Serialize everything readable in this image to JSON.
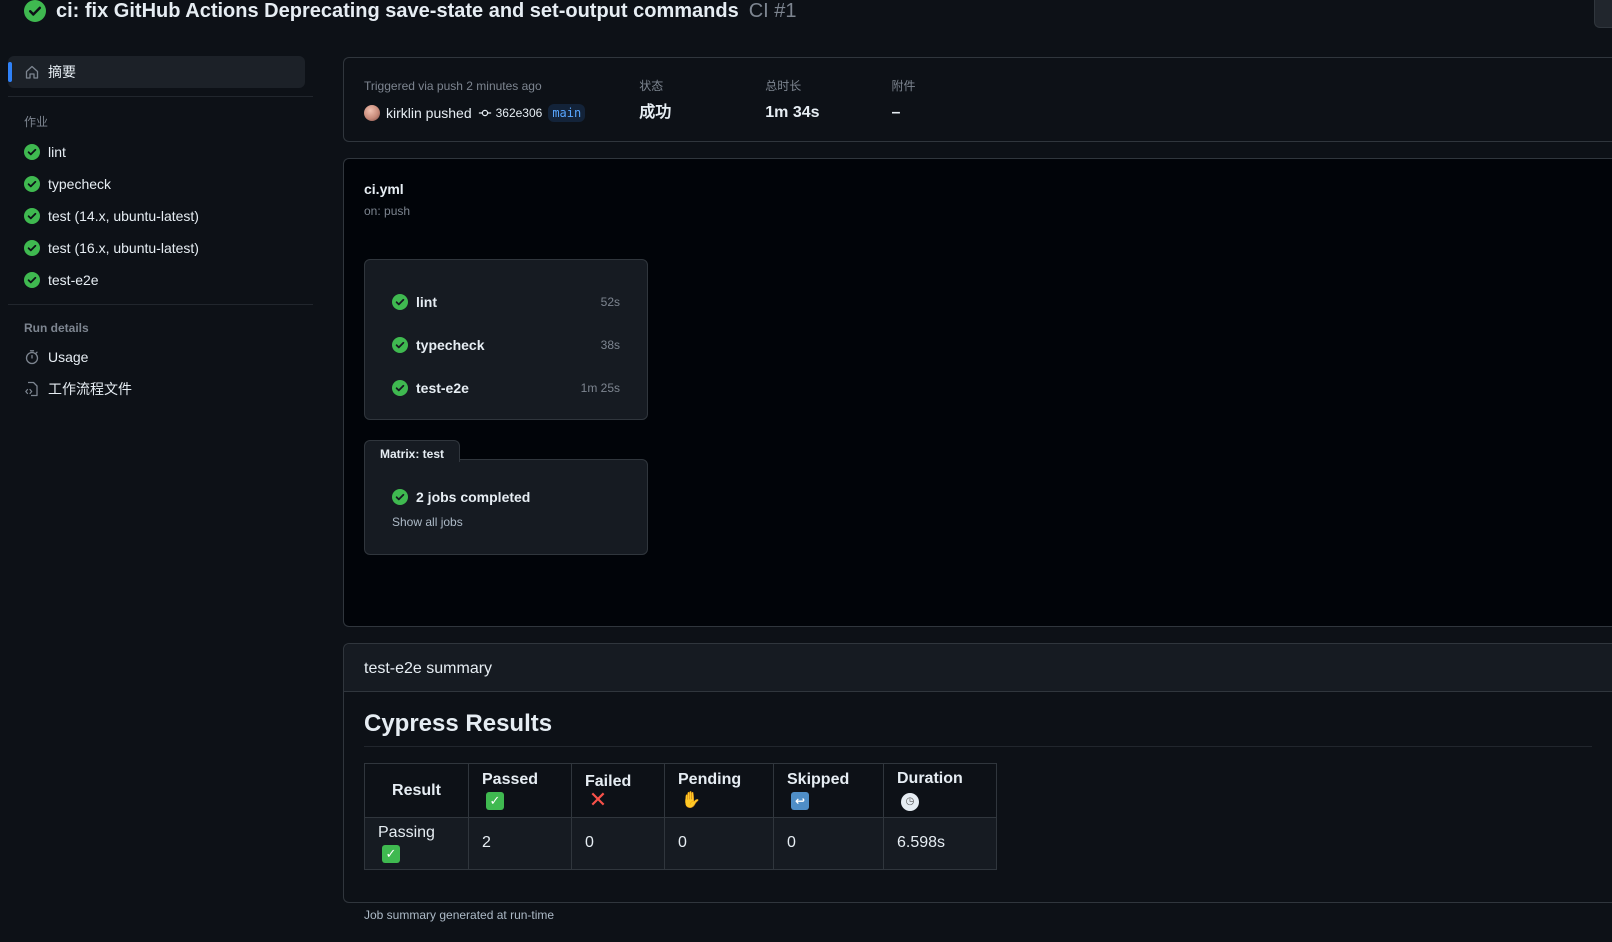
{
  "header": {
    "title": "ci: fix GitHub Actions Deprecating save-state and set-output commands",
    "run_id": "CI #1"
  },
  "sidebar": {
    "summary_label": "摘要",
    "jobs_heading": "作业",
    "jobs": [
      {
        "label": "lint"
      },
      {
        "label": "typecheck"
      },
      {
        "label": "test (14.x, ubuntu-latest)"
      },
      {
        "label": "test (16.x, ubuntu-latest)"
      },
      {
        "label": "test-e2e"
      }
    ],
    "run_details_heading": "Run details",
    "usage_label": "Usage",
    "workflow_file_label": "工作流程文件"
  },
  "trigger": {
    "text": "Triggered via push 2 minutes ago",
    "actor_text": "kirklin pushed",
    "commit": "362e306",
    "branch": "main",
    "status_label": "状态",
    "status_value": "成功",
    "duration_label": "总时长",
    "duration_value": "1m 34s",
    "artifacts_label": "附件",
    "artifacts_value": "–"
  },
  "workflow": {
    "file": "ci.yml",
    "on": "on: push",
    "jobs": [
      {
        "name": "lint",
        "duration": "52s"
      },
      {
        "name": "typecheck",
        "duration": "38s"
      },
      {
        "name": "test-e2e",
        "duration": "1m 25s"
      }
    ],
    "matrix_label": "Matrix: test",
    "matrix_status": "2 jobs completed",
    "matrix_show_all": "Show all jobs"
  },
  "summary": {
    "heading": "test-e2e summary",
    "title": "Cypress Results",
    "columns": [
      "Result",
      "Passed",
      "Failed",
      "Pending",
      "Skipped",
      "Duration"
    ],
    "row": [
      "Passing",
      "2",
      "0",
      "0",
      "0",
      "6.598s"
    ],
    "footer": "Job summary generated at run-time"
  },
  "colors": {
    "success": "#3fb950",
    "accent": "#2f81f7",
    "background": "#0d1117"
  }
}
